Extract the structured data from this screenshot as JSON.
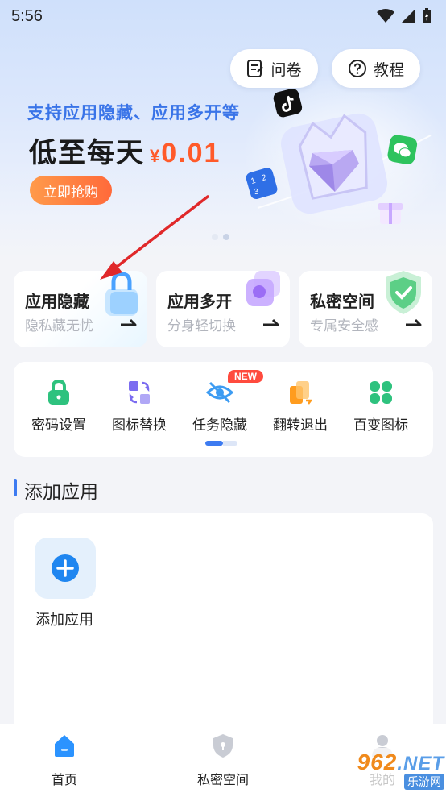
{
  "status_bar": {
    "time": "5:56"
  },
  "header": {
    "survey_label": "问卷",
    "tutorial_label": "教程"
  },
  "banner": {
    "subtitle": "支持应用隐藏、应用多开等",
    "headline": "低至每天",
    "currency": "¥",
    "price": "0.01",
    "buy_label": "立即抢购",
    "slide_count": 2,
    "active_slide": 1
  },
  "features": [
    {
      "title": "应用隐藏",
      "subtitle": "隐私藏无忧",
      "icon": "lock-icon"
    },
    {
      "title": "应用多开",
      "subtitle": "分身轻切换",
      "icon": "stack-icon"
    },
    {
      "title": "私密空间",
      "subtitle": "专属安全感",
      "icon": "shield-icon"
    }
  ],
  "tools": [
    {
      "label": "密码设置",
      "icon": "lock-icon"
    },
    {
      "label": "图标替换",
      "icon": "swap-icon"
    },
    {
      "label": "任务隐藏",
      "icon": "eye-off-icon",
      "badge": "NEW"
    },
    {
      "label": "翻转退出",
      "icon": "flip-icon"
    },
    {
      "label": "百变图标",
      "icon": "clover-icon"
    }
  ],
  "section": {
    "title": "添加应用"
  },
  "apps": {
    "add_label": "添加应用"
  },
  "bottom_nav": [
    {
      "label": "首页",
      "active": true
    },
    {
      "label": "私密空间",
      "active": false
    },
    {
      "label": "我的",
      "active": false
    }
  ],
  "watermark": {
    "brand": "962",
    "suffix": ".NET",
    "caption": "乐游网"
  },
  "colors": {
    "accent": "#3d7bf1",
    "promo_orange": "#ff6a3a",
    "price_red": "#ff5a2a",
    "tool_green": "#2ec27e",
    "badge_red": "#ff4b3e"
  }
}
